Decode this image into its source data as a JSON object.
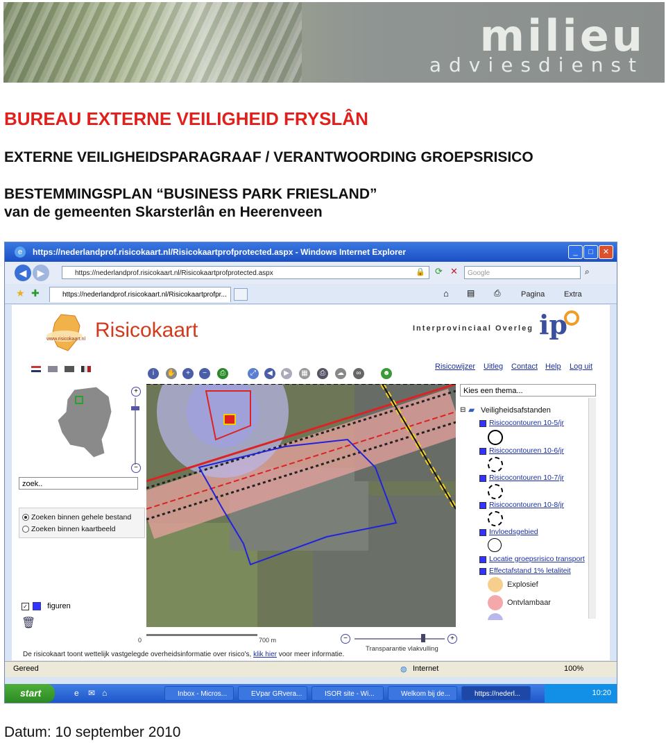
{
  "banner": {
    "brand_main": "milieu",
    "brand_sub": "adviesdienst"
  },
  "header": {
    "title": "BUREAU EXTERNE VEILIGHEID FRYSLÂN",
    "subtitle": "EXTERNE VEILIGHEIDSPARAGRAAF / VERANTWOORDING GROEPSRISICO",
    "plan": "BESTEMMINGSPLAN “BUSINESS PARK FRIESLAND”",
    "municipalities": "van de gemeenten Skarsterlân en Heerenveen"
  },
  "browser": {
    "window_title": "https://nederlandprof.risicokaart.nl/Risicokaartprofprotected.aspx - Windows Internet Explorer",
    "address": "https://nederlandprof.risicokaart.nl/Risicokaartprofprotected.aspx",
    "search_placeholder": "Google",
    "tab_label": "https://nederlandprof.risicokaart.nl/Risicokaartprofpr...",
    "toolbar_pagina": "Pagina",
    "toolbar_extra": "Extra",
    "status": "Gereed",
    "zone": "Internet",
    "zoom": "100%"
  },
  "risicokaart": {
    "title": "Risicokaart",
    "logo_text": "www.risicokaart.nl",
    "ipo_text": "Interprovinciaal Overleg",
    "ipo_logo": "ip",
    "links": [
      "Risicowijzer",
      "Uitleg",
      "Contact",
      "Help",
      "Log uit"
    ],
    "search_value": "zoek..",
    "radio_1": "Zoeken binnen gehele bestand",
    "radio_2": "Zoeken binnen kaartbeeld",
    "figuren": "figuren",
    "scale_label": "700 m",
    "scale_zero": "0",
    "disclaimer_pre": "De risicokaart toont wettelijk vastgelegde overheidsinformatie over risico's,",
    "disclaimer_link": "klik hier",
    "disclaimer_post": "voor meer informatie.",
    "transparency": "Transparantie vlakvulling",
    "thema_select": "Kies een thema...",
    "legend_group": "Veiligheidsafstanden",
    "legend": {
      "rc5": "Risicocontouren 10-5/jr",
      "rc6": "Risicocontouren 10-6/jr",
      "rc7": "Risicocontouren 10-7/jr",
      "rc8": "Risicocontouren 10-8/jr",
      "invloed": "Invloedsgebied",
      "locatie": "Locatie groepsrisico transport",
      "effect": "Effectafstand 1% letaliteit",
      "explosief": "Explosief",
      "ontvlambaar": "Ontvlambaar"
    }
  },
  "taskbar": {
    "start": "start",
    "items": [
      "Inbox - Micros...",
      "EVpar GRvera...",
      "ISOR site - Wi...",
      "Welkom bij de...",
      "https://nederl..."
    ],
    "clock": "10:20"
  },
  "footer": {
    "date": "Datum: 10 september 2010"
  },
  "colors": {
    "title_red": "#e0201c",
    "risico_red": "#d23a1c",
    "link_blue": "#1a2fa0"
  }
}
